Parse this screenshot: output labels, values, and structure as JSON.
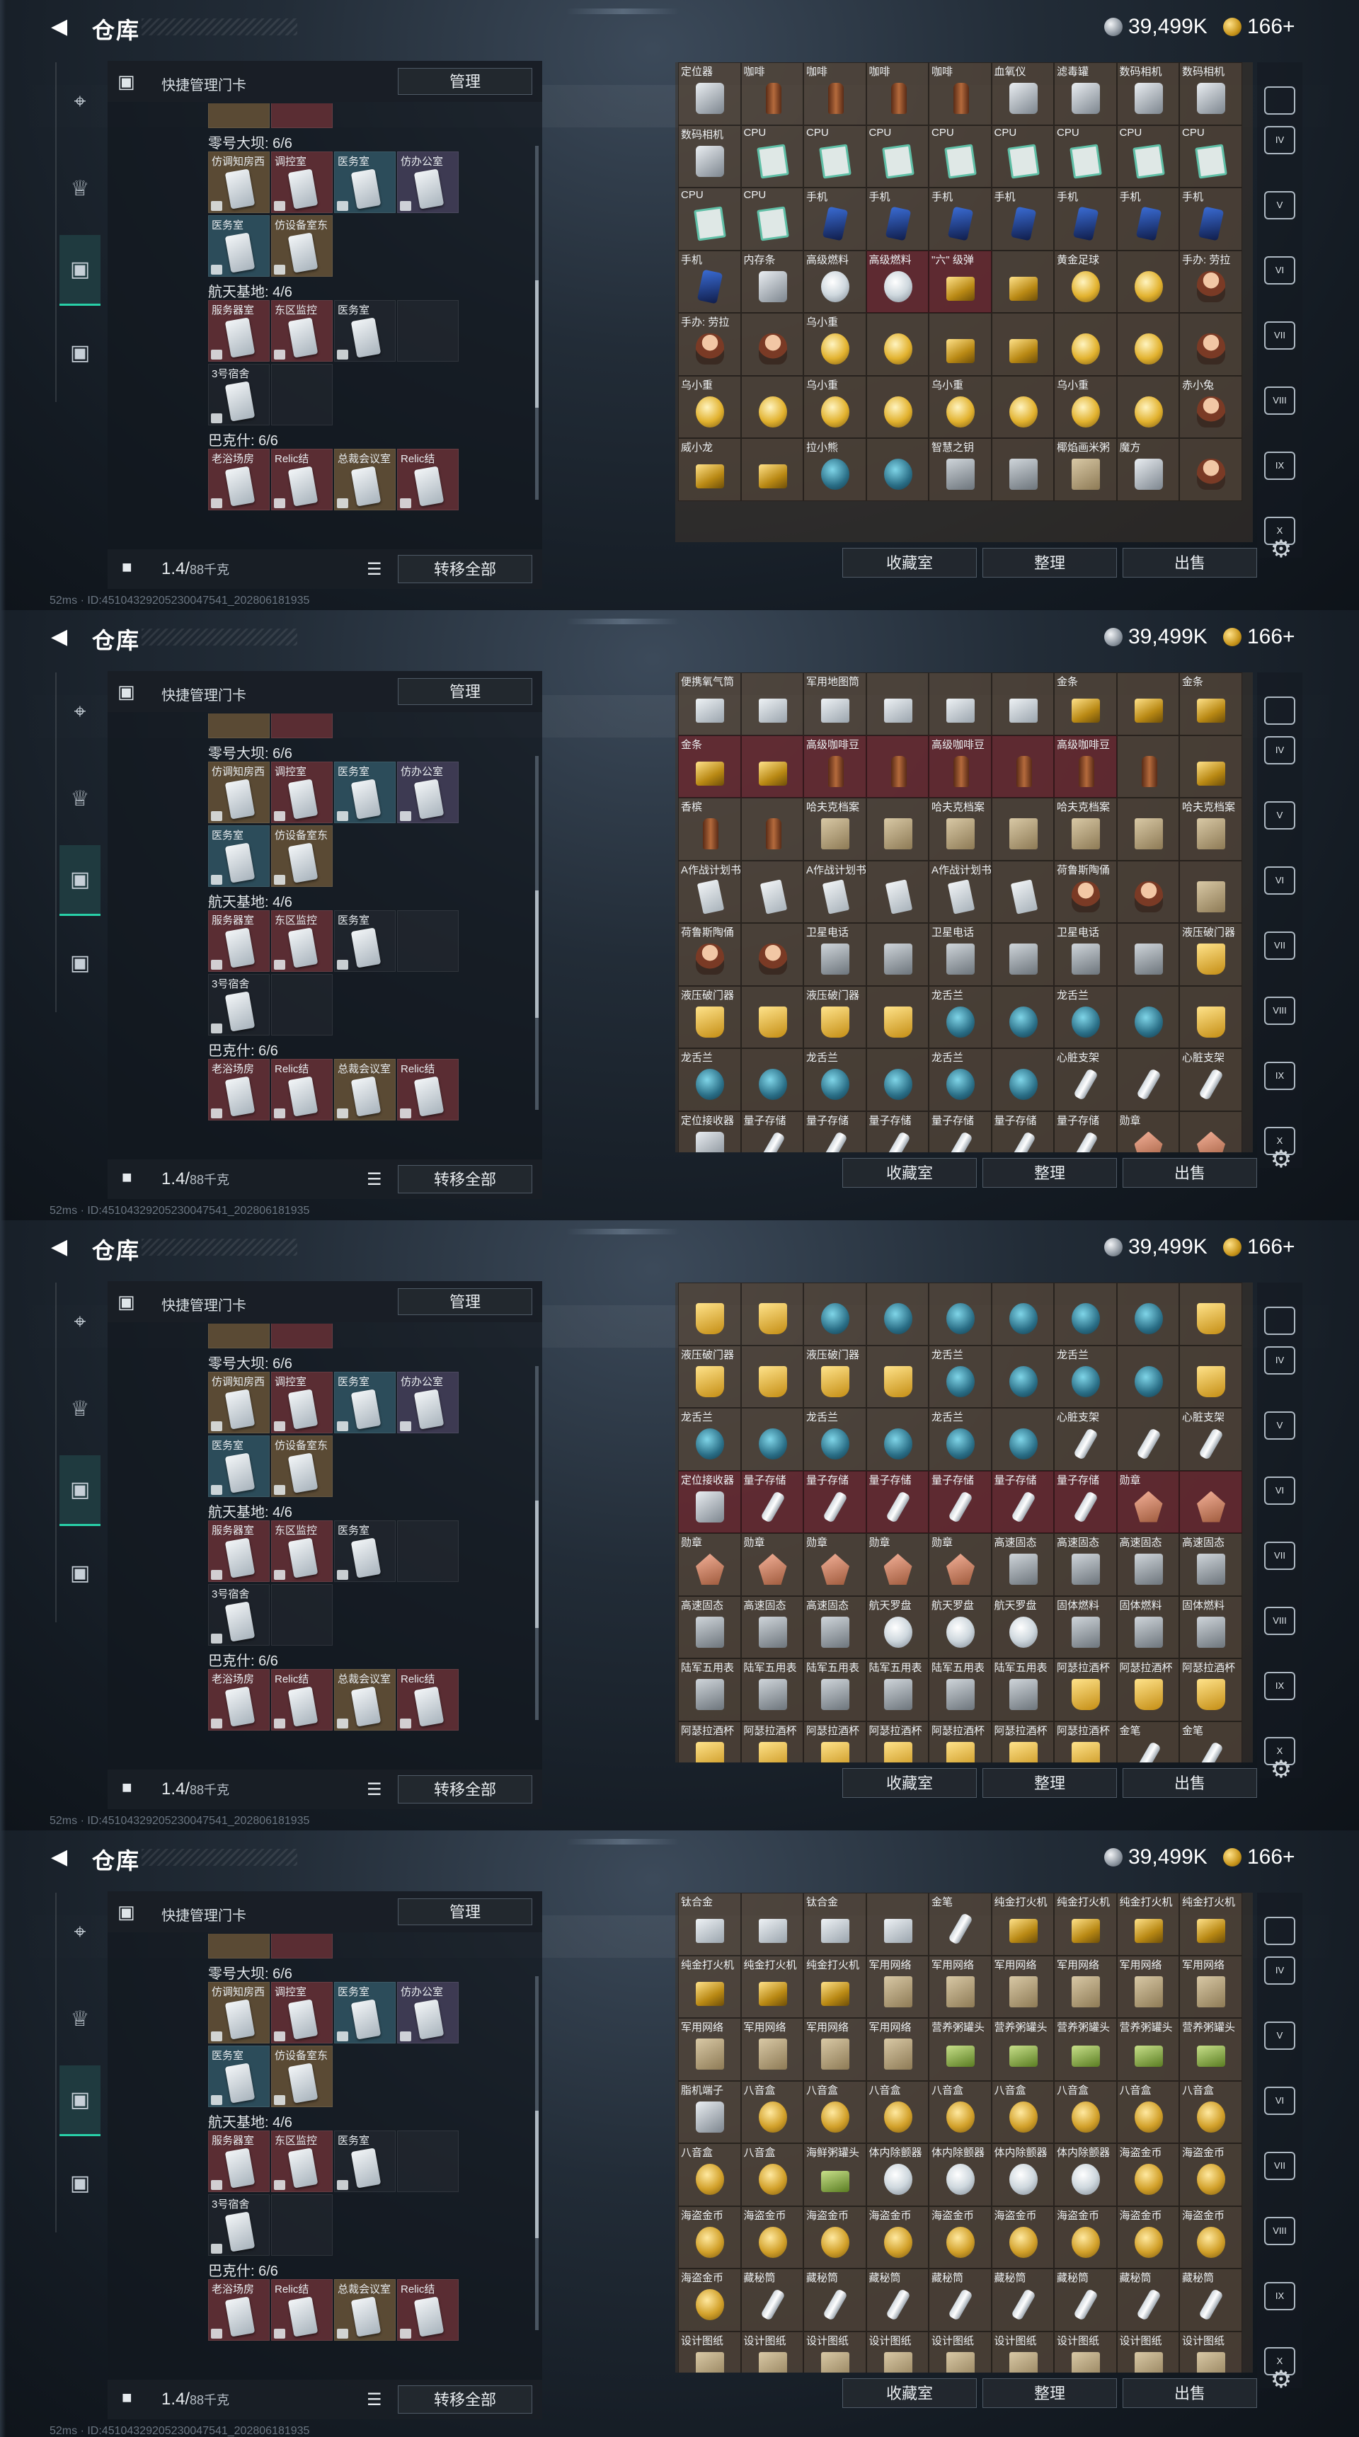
{
  "topbar": {
    "title": "仓库",
    "silver": "39,499K",
    "gold": "166+"
  },
  "left": {
    "header": "快捷管理门卡",
    "manage": "管理",
    "groups": [
      "零号大坝: 6/6",
      "航天基地: 4/6",
      "巴克什: 6/6"
    ],
    "cardsA": [
      "仿调知房西",
      "调控室",
      "医务室",
      "仿办公室",
      "医务室",
      "仿设备室东"
    ],
    "cardsB": [
      "服务器室",
      "东区监控",
      "医务室"
    ],
    "cardsB2": [
      "3号宿舍"
    ],
    "cardsC": [
      "老浴场房",
      "Relic结",
      "总裁会议室",
      "Relic结"
    ],
    "weight": "1.4/",
    "weight_max": "88千克",
    "transfer": "转移全部"
  },
  "right": {
    "btn1": "收藏室",
    "btn2": "整理",
    "btn3": "出售"
  },
  "rightnav": [
    "IV",
    "V",
    "VI",
    "VII",
    "VIII",
    "IX",
    "X"
  ],
  "statusbar": "52ms · ID:45104329205230047541_202806181935",
  "panels": [
    {
      "items": [
        [
          "定位器",
          "gray"
        ],
        [
          "咖啡",
          "bottle"
        ],
        [
          "咖啡",
          "bottle"
        ],
        [
          "咖啡",
          "bottle"
        ],
        [
          "咖啡",
          "bottle"
        ],
        [
          "血氧仪",
          "gray"
        ],
        [
          "滤毒罐",
          "gray"
        ],
        [
          "数码相机",
          "gray"
        ],
        [
          "数码相机",
          "gray"
        ],
        [
          "数码相机",
          "gray"
        ],
        [
          "CPU",
          "cpu"
        ],
        [
          "CPU",
          "cpu"
        ],
        [
          "CPU",
          "cpu"
        ],
        [
          "CPU",
          "cpu"
        ],
        [
          "CPU",
          "cpu"
        ],
        [
          "CPU",
          "cpu"
        ],
        [
          "CPU",
          "cpu"
        ],
        [
          "CPU",
          "cpu"
        ],
        [
          "CPU",
          "cpu"
        ],
        [
          "CPU",
          "cpu"
        ],
        [
          "手机",
          "phone"
        ],
        [
          "手机",
          "phone"
        ],
        [
          "手机",
          "phone"
        ],
        [
          "手机",
          "phone"
        ],
        [
          "手机",
          "phone"
        ],
        [
          "手机",
          "phone"
        ],
        [
          "手机",
          "phone"
        ],
        [
          "手机",
          "phone"
        ],
        [
          "内存条",
          "gray"
        ],
        [
          "高级燃料",
          "can"
        ],
        [
          "高级燃料",
          "can"
        ],
        [
          "\"六\" 级弹",
          "gold"
        ],
        [
          "",
          "gold"
        ],
        [
          "黄金足球",
          "ball"
        ],
        [
          "",
          "ball"
        ],
        [
          "手办: 劳拉",
          "doll"
        ],
        [
          "手办: 劳拉",
          "doll"
        ],
        [
          "",
          "doll"
        ],
        [
          "乌小重",
          "ball"
        ],
        [
          "",
          "ball"
        ],
        [
          "",
          "gold"
        ],
        [
          "",
          "gold"
        ],
        [
          "",
          "ball"
        ],
        [
          "",
          "ball"
        ],
        [
          "",
          "doll"
        ],
        [
          "乌小重",
          "ball"
        ],
        [
          "",
          "ball"
        ],
        [
          "乌小重",
          "ball"
        ],
        [
          "",
          "ball"
        ],
        [
          "乌小重",
          "ball"
        ],
        [
          "",
          "ball"
        ],
        [
          "乌小重",
          "ball"
        ],
        [
          "",
          "ball"
        ],
        [
          "赤小兔",
          "doll"
        ],
        [
          "威小龙",
          "gold"
        ],
        [
          "",
          "gold"
        ],
        [
          "拉小熊",
          "teal"
        ],
        [
          "",
          "teal"
        ],
        [
          "智慧之钥",
          "lock2"
        ],
        [
          "",
          "lock2"
        ],
        [
          "椰焰画米粥",
          "box"
        ],
        [
          "魔方",
          "gray"
        ],
        [
          "",
          "doll"
        ]
      ]
    },
    {
      "items": [
        [
          "便携氧气筒",
          "silver"
        ],
        [
          "",
          "silver"
        ],
        [
          "军用地图筒",
          "silver"
        ],
        [
          "",
          "silver"
        ],
        [
          "",
          "silver"
        ],
        [
          "",
          "silver"
        ],
        [
          "金条",
          "gold"
        ],
        [
          "",
          "gold"
        ],
        [
          "金条",
          "gold"
        ],
        [
          "金条",
          "gold"
        ],
        [
          "",
          "gold"
        ],
        [
          "高级咖啡豆",
          "bottle"
        ],
        [
          "",
          "bottle"
        ],
        [
          "高级咖啡豆",
          "bottle"
        ],
        [
          "",
          "bottle"
        ],
        [
          "高级咖啡豆",
          "bottle"
        ],
        [
          "",
          "bottle"
        ],
        [
          "",
          "gold"
        ],
        [
          "香槟",
          "bottle"
        ],
        [
          "",
          "bottle"
        ],
        [
          "哈夫克档案",
          "box"
        ],
        [
          "",
          "box"
        ],
        [
          "哈夫克档案",
          "box"
        ],
        [
          "",
          "box"
        ],
        [
          "哈夫克档案",
          "box"
        ],
        [
          "",
          "box"
        ],
        [
          "哈夫克档案",
          "box"
        ],
        [
          "A作战计划书",
          "card2"
        ],
        [
          "",
          "card2"
        ],
        [
          "A作战计划书",
          "card2"
        ],
        [
          "",
          "card2"
        ],
        [
          "A作战计划书",
          "card2"
        ],
        [
          "",
          "card2"
        ],
        [
          "荷鲁斯陶俑",
          "doll"
        ],
        [
          "",
          "doll"
        ],
        [
          "",
          "box"
        ],
        [
          "荷鲁斯陶俑",
          "doll"
        ],
        [
          "",
          "doll"
        ],
        [
          "卫星电话",
          "lock2"
        ],
        [
          "",
          "lock2"
        ],
        [
          "卫星电话",
          "lock2"
        ],
        [
          "",
          "lock2"
        ],
        [
          "卫星电话",
          "lock2"
        ],
        [
          "",
          "lock2"
        ],
        [
          "液压破门器",
          "cup"
        ],
        [
          "液压破门器",
          "cup"
        ],
        [
          "",
          "cup"
        ],
        [
          "液压破门器",
          "cup"
        ],
        [
          "",
          "cup"
        ],
        [
          "龙舌兰",
          "teal"
        ],
        [
          "",
          "teal"
        ],
        [
          "龙舌兰",
          "teal"
        ],
        [
          "",
          "teal"
        ],
        [
          "",
          "cup"
        ],
        [
          "龙舌兰",
          "teal"
        ],
        [
          "",
          "teal"
        ],
        [
          "龙舌兰",
          "teal"
        ],
        [
          "",
          "teal"
        ],
        [
          "龙舌兰",
          "teal"
        ],
        [
          "",
          "teal"
        ],
        [
          "心脏支架",
          "tube"
        ],
        [
          "",
          "tube"
        ],
        [
          "心脏支架",
          "tube"
        ],
        [
          "定位接收器",
          "gray"
        ],
        [
          "量子存储",
          "tube"
        ],
        [
          "量子存储",
          "tube"
        ],
        [
          "量子存储",
          "tube"
        ],
        [
          "量子存储",
          "tube"
        ],
        [
          "量子存储",
          "tube"
        ],
        [
          "量子存储",
          "tube"
        ],
        [
          "勋章",
          "badge"
        ],
        [
          "",
          "badge"
        ]
      ]
    },
    {
      "items": [
        [
          "",
          "cup"
        ],
        [
          "",
          "cup"
        ],
        [
          "",
          "teal"
        ],
        [
          "",
          "teal"
        ],
        [
          "",
          "teal"
        ],
        [
          "",
          "teal"
        ],
        [
          "",
          "teal"
        ],
        [
          "",
          "teal"
        ],
        [
          "",
          "cup"
        ],
        [
          "液压破门器",
          "cup"
        ],
        [
          "",
          "cup"
        ],
        [
          "液压破门器",
          "cup"
        ],
        [
          "",
          "cup"
        ],
        [
          "龙舌兰",
          "teal"
        ],
        [
          "",
          "teal"
        ],
        [
          "龙舌兰",
          "teal"
        ],
        [
          "",
          "teal"
        ],
        [
          "",
          "cup"
        ],
        [
          "龙舌兰",
          "teal"
        ],
        [
          "",
          "teal"
        ],
        [
          "龙舌兰",
          "teal"
        ],
        [
          "",
          "teal"
        ],
        [
          "龙舌兰",
          "teal"
        ],
        [
          "",
          "teal"
        ],
        [
          "心脏支架",
          "tube"
        ],
        [
          "",
          "tube"
        ],
        [
          "心脏支架",
          "tube"
        ],
        [
          "定位接收器",
          "gray"
        ],
        [
          "量子存储",
          "tube"
        ],
        [
          "量子存储",
          "tube"
        ],
        [
          "量子存储",
          "tube"
        ],
        [
          "量子存储",
          "tube"
        ],
        [
          "量子存储",
          "tube"
        ],
        [
          "量子存储",
          "tube"
        ],
        [
          "勋章",
          "badge"
        ],
        [
          "",
          "badge"
        ],
        [
          "勋章",
          "badge"
        ],
        [
          "勋章",
          "badge"
        ],
        [
          "勋章",
          "badge"
        ],
        [
          "勋章",
          "badge"
        ],
        [
          "勋章",
          "badge"
        ],
        [
          "高速固态",
          "lock2"
        ],
        [
          "高速固态",
          "lock2"
        ],
        [
          "高速固态",
          "lock2"
        ],
        [
          "高速固态",
          "lock2"
        ],
        [
          "高速固态",
          "lock2"
        ],
        [
          "高速固态",
          "lock2"
        ],
        [
          "高速固态",
          "lock2"
        ],
        [
          "航天罗盘",
          "can"
        ],
        [
          "航天罗盘",
          "can"
        ],
        [
          "航天罗盘",
          "can"
        ],
        [
          "固体燃料",
          "lock2"
        ],
        [
          "固体燃料",
          "lock2"
        ],
        [
          "固体燃料",
          "lock2"
        ],
        [
          "陆军五用表",
          "lock2"
        ],
        [
          "陆军五用表",
          "lock2"
        ],
        [
          "陆军五用表",
          "lock2"
        ],
        [
          "陆军五用表",
          "lock2"
        ],
        [
          "陆军五用表",
          "lock2"
        ],
        [
          "陆军五用表",
          "lock2"
        ],
        [
          "阿瑟拉酒杯",
          "cup"
        ],
        [
          "阿瑟拉酒杯",
          "cup"
        ],
        [
          "阿瑟拉酒杯",
          "cup"
        ],
        [
          "阿瑟拉酒杯",
          "cup"
        ],
        [
          "阿瑟拉酒杯",
          "cup"
        ],
        [
          "阿瑟拉酒杯",
          "cup"
        ],
        [
          "阿瑟拉酒杯",
          "cup"
        ],
        [
          "阿瑟拉酒杯",
          "cup"
        ],
        [
          "阿瑟拉酒杯",
          "cup"
        ],
        [
          "阿瑟拉酒杯",
          "cup"
        ],
        [
          "金笔",
          "tube"
        ],
        [
          "金笔",
          "tube"
        ]
      ]
    },
    {
      "items": [
        [
          "钛合金",
          "silver"
        ],
        [
          "",
          "silver"
        ],
        [
          "钛合金",
          "silver"
        ],
        [
          "",
          "silver"
        ],
        [
          "金笔",
          "tube"
        ],
        [
          "纯金打火机",
          "gold"
        ],
        [
          "纯金打火机",
          "gold"
        ],
        [
          "纯金打火机",
          "gold"
        ],
        [
          "纯金打火机",
          "gold"
        ],
        [
          "纯金打火机",
          "gold"
        ],
        [
          "纯金打火机",
          "gold"
        ],
        [
          "纯金打火机",
          "gold"
        ],
        [
          "军用网络",
          "box"
        ],
        [
          "军用网络",
          "box"
        ],
        [
          "军用网络",
          "box"
        ],
        [
          "军用网络",
          "box"
        ],
        [
          "军用网络",
          "box"
        ],
        [
          "军用网络",
          "box"
        ],
        [
          "军用网络",
          "box"
        ],
        [
          "军用网络",
          "box"
        ],
        [
          "军用网络",
          "box"
        ],
        [
          "军用网络",
          "box"
        ],
        [
          "营养粥罐头",
          "can2"
        ],
        [
          "营养粥罐头",
          "can2"
        ],
        [
          "营养粥罐头",
          "can2"
        ],
        [
          "营养粥罐头",
          "can2"
        ],
        [
          "营养粥罐头",
          "can2"
        ],
        [
          "脂机端子",
          "gray"
        ],
        [
          "八音盒",
          "coin"
        ],
        [
          "八音盒",
          "coin"
        ],
        [
          "八音盒",
          "coin"
        ],
        [
          "八音盒",
          "coin"
        ],
        [
          "八音盒",
          "coin"
        ],
        [
          "八音盒",
          "coin"
        ],
        [
          "八音盒",
          "coin"
        ],
        [
          "八音盒",
          "coin"
        ],
        [
          "八音盒",
          "coin"
        ],
        [
          "八音盒",
          "coin"
        ],
        [
          "海鲜粥罐头",
          "can2"
        ],
        [
          "体内除颤器",
          "can"
        ],
        [
          "体内除颤器",
          "can"
        ],
        [
          "体内除颤器",
          "can"
        ],
        [
          "体内除颤器",
          "can"
        ],
        [
          "海盗金币",
          "coin"
        ],
        [
          "海盗金币",
          "coin"
        ],
        [
          "海盗金币",
          "coin"
        ],
        [
          "海盗金币",
          "coin"
        ],
        [
          "海盗金币",
          "coin"
        ],
        [
          "海盗金币",
          "coin"
        ],
        [
          "海盗金币",
          "coin"
        ],
        [
          "海盗金币",
          "coin"
        ],
        [
          "海盗金币",
          "coin"
        ],
        [
          "海盗金币",
          "coin"
        ],
        [
          "海盗金币",
          "coin"
        ],
        [
          "海盗金币",
          "coin"
        ],
        [
          "藏秘筒",
          "tube"
        ],
        [
          "藏秘筒",
          "tube"
        ],
        [
          "藏秘筒",
          "tube"
        ],
        [
          "藏秘筒",
          "tube"
        ],
        [
          "藏秘筒",
          "tube"
        ],
        [
          "藏秘筒",
          "tube"
        ],
        [
          "藏秘筒",
          "tube"
        ],
        [
          "藏秘筒",
          "tube"
        ],
        [
          "设计图纸",
          "box"
        ],
        [
          "设计图纸",
          "box"
        ],
        [
          "设计图纸",
          "box"
        ],
        [
          "设计图纸",
          "box"
        ],
        [
          "设计图纸",
          "box"
        ],
        [
          "设计图纸",
          "box"
        ],
        [
          "设计图纸",
          "box"
        ],
        [
          "设计图纸",
          "box"
        ],
        [
          "设计图纸",
          "box"
        ]
      ]
    }
  ]
}
